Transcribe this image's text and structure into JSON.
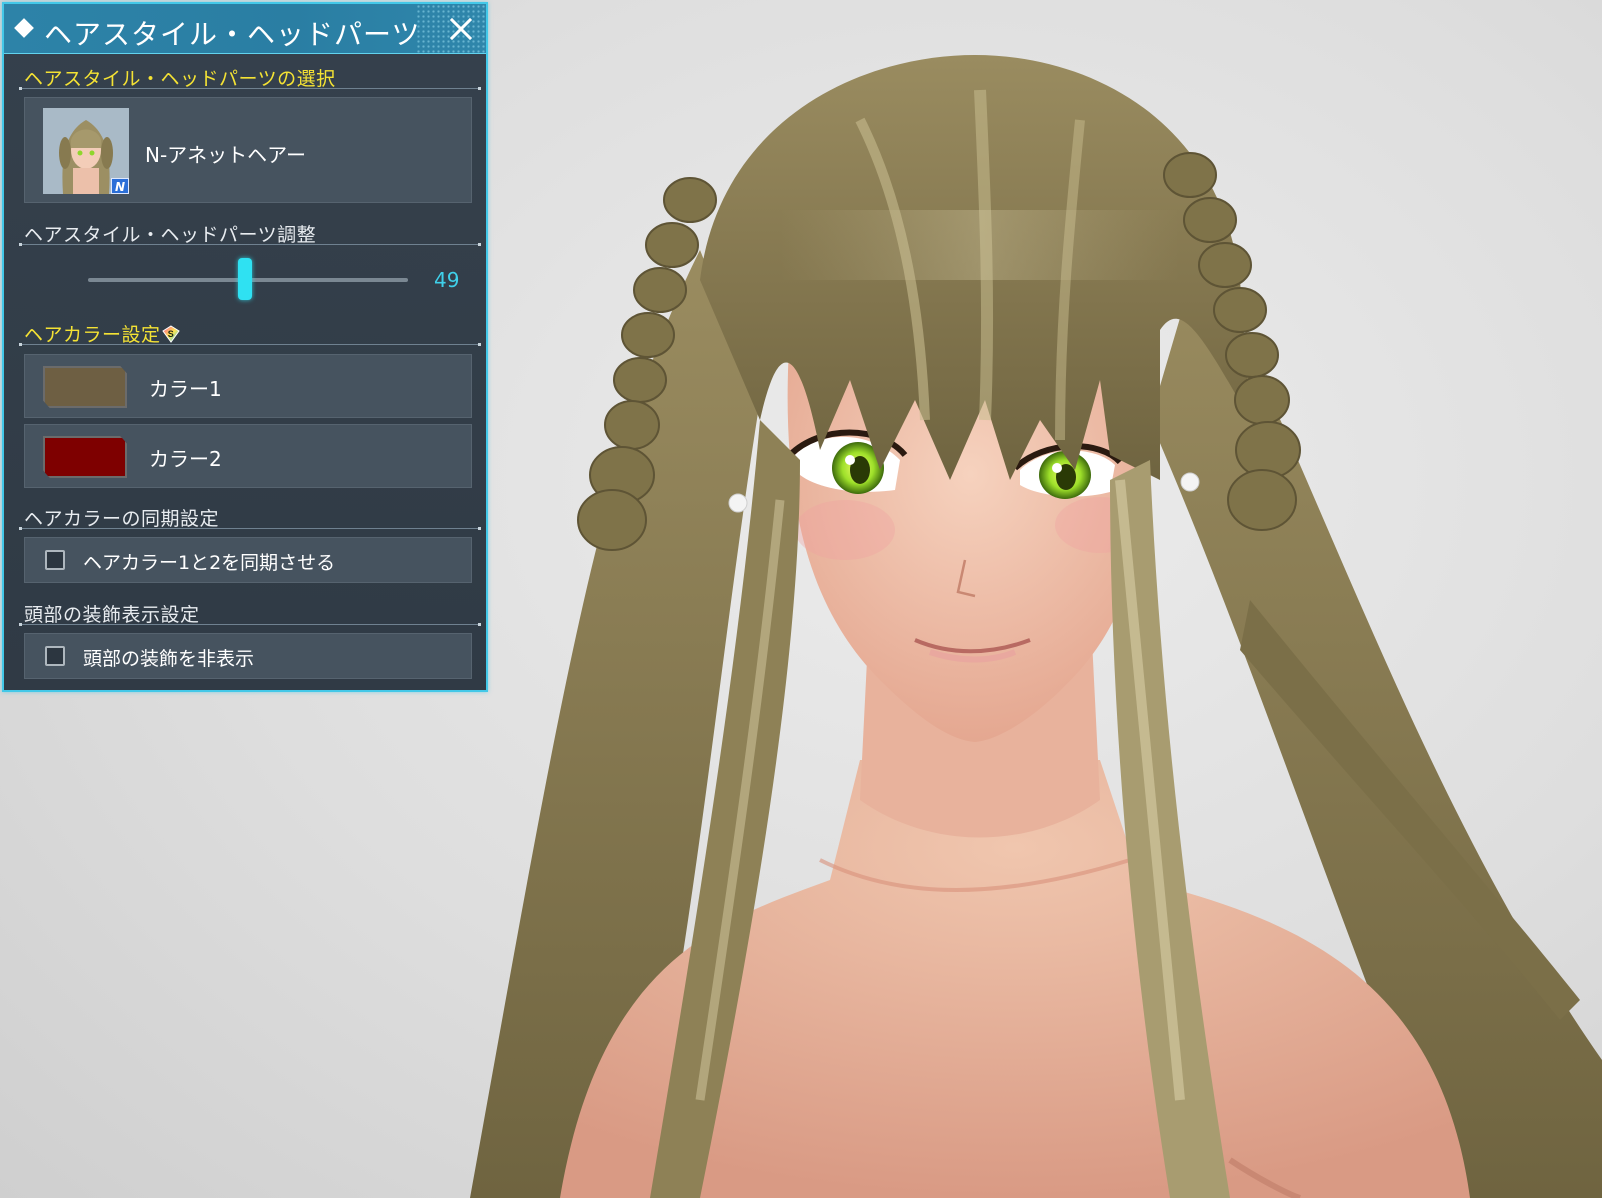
{
  "window": {
    "title": "ヘアスタイル・ヘッドパーツ",
    "close_icon": "close-icon"
  },
  "hair_select": {
    "section_title": "ヘアスタイル・ヘッドパーツの選択",
    "item_name": "N-アネットヘアー",
    "badge": "N"
  },
  "adjust": {
    "section_title": "ヘアスタイル・ヘッドパーツ調整",
    "slider_value": 49,
    "slider_display": "49"
  },
  "hair_color": {
    "section_title": "ヘアカラー設定",
    "section_icon": "sg-gem-icon",
    "colors": [
      {
        "label": "カラー1",
        "swatch": "#6e5f43"
      },
      {
        "label": "カラー2",
        "swatch": "#7e0000"
      }
    ]
  },
  "sync": {
    "section_title": "ヘアカラーの同期設定",
    "checkbox_label": "ヘアカラー1と2を同期させる",
    "checked": false
  },
  "head_deco": {
    "section_title": "頭部の装飾表示設定",
    "checkbox_label": "頭部の装飾を非表示",
    "checked": false
  },
  "colors": {
    "panel_border": "#43c8e8",
    "title_bar": "#2d83a8",
    "accent_yellow": "#f4e234",
    "slider_accent": "#2fe1f2",
    "hair": "#8a7d52",
    "skin": "#f0c0a8",
    "eyes": "#9ee02a"
  }
}
